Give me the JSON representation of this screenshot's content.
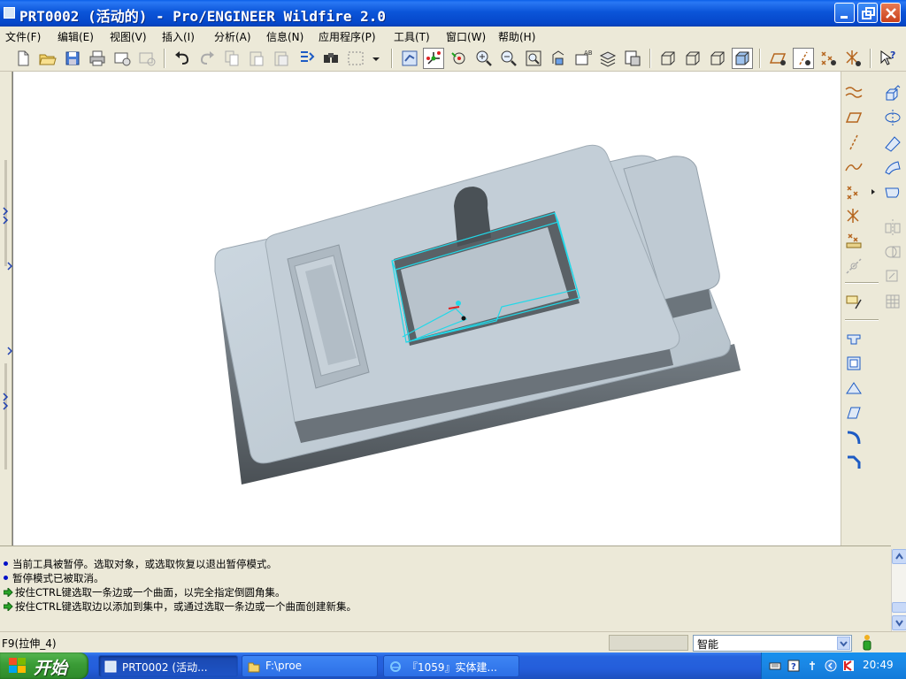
{
  "window": {
    "title": "PRT0002 (活动的) - Pro/ENGINEER Wildfire 2.0",
    "controls": [
      "minimize-icon",
      "maximize-icon",
      "close-icon"
    ]
  },
  "menu": {
    "items": [
      "文件(F)",
      "编辑(E)",
      "视图(V)",
      "插入(I)",
      "分析(A)",
      "信息(N)",
      "应用程序(P)",
      "工具(T)",
      "窗口(W)",
      "帮助(H)"
    ]
  },
  "toolbar": {
    "icons": [
      "new-file-icon",
      "open-folder-icon",
      "save-icon",
      "print-icon",
      "send-mail-icon",
      "disabled-mail-icon",
      "undo-icon",
      "redo-icon",
      "copy-icon",
      "paste-icon",
      "paste-special-icon",
      "regenerate-icon",
      "find-icon",
      "select-box-icon",
      "dropdown-arrow-icon",
      "repaint-icon",
      "spin-center-icon",
      "orient-mode-icon",
      "zoom-in-icon",
      "zoom-out-icon",
      "refit-icon",
      "reorient-icon",
      "saved-views-icon",
      "layers-icon",
      "view-manager-icon",
      "wireframe-icon",
      "hidden-line-icon",
      "no-hidden-icon",
      "shading-icon",
      "datum-planes-icon",
      "datum-axes-icon",
      "datum-points-icon",
      "coordinate-systems-icon",
      "context-help-icon"
    ]
  },
  "right_toolbar": {
    "icons": [
      "sketched-curve-icon",
      "datum-plane-icon",
      "datum-axis-icon",
      "datum-curve-icon",
      "datum-point-icon",
      "coordinate-system-icon",
      "analysis-feature-icon",
      "datum-disabled-icon",
      "sketch-tool-icon",
      "hole-icon",
      "shell-icon",
      "rib-icon",
      "draft-icon",
      "round-icon",
      "chamfer-icon",
      "extrude-icon",
      "revolve-icon",
      "variable-sweep-icon",
      "boundary-blend-icon",
      "style-icon",
      "mirror-icon",
      "merge-disabled-icon",
      "trim-disabled-icon",
      "pattern-disabled-icon",
      "intersect-disabled-icon"
    ]
  },
  "messages": [
    {
      "type": "info",
      "text": "当前工具被暂停。选取对象，或选取恢复以退出暂停模式。"
    },
    {
      "type": "info",
      "text": "暂停模式已被取消。"
    },
    {
      "type": "prompt",
      "text": "按住CTRL键选取一条边或一个曲面，以完全指定倒圆角集。"
    },
    {
      "type": "prompt",
      "text": "按住CTRL键选取边以添加到集中，或通过选取一条边或一个曲面创建新集。"
    }
  ],
  "status": {
    "text": "F9(拉伸_4)",
    "filter_value": "智能"
  },
  "taskbar": {
    "start_label": "开始",
    "tasks": [
      {
        "label": "PRT0002 (活动..."
      },
      {
        "label": "F:\\proe"
      },
      {
        "label": "『1059』实体建..."
      }
    ],
    "clock": "20:49"
  },
  "colors": {
    "part_light": "#c9d5df",
    "part_mid": "#a9b4bd",
    "part_dark": "#555b60",
    "preview_cyan": "#22d8e8",
    "titlebar_blue": "#0b55d9"
  }
}
